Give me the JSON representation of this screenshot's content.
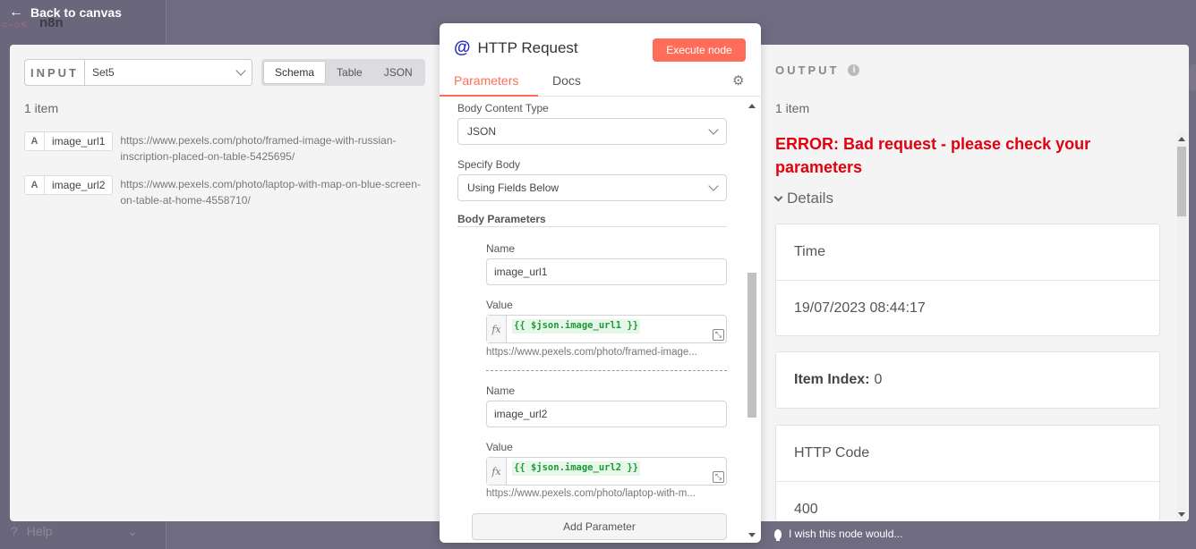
{
  "background": {
    "back_label": "Back to canvas",
    "logo_text": "n8n",
    "help_label": "Help"
  },
  "input": {
    "label": "INPUT",
    "source_node": "Set5",
    "views": [
      "Schema",
      "Table",
      "JSON"
    ],
    "active_view": "Schema",
    "item_count": "1 item",
    "fields": [
      {
        "type": "A",
        "key": "image_url1",
        "value": "https://www.pexels.com/photo/framed-image-with-russian-inscription-placed-on-table-5425695/"
      },
      {
        "type": "A",
        "key": "image_url2",
        "value": "https://www.pexels.com/photo/laptop-with-map-on-blue-screen-on-table-at-home-4558710/"
      }
    ]
  },
  "node": {
    "icon": "@",
    "title": "HTTP Request",
    "execute_label": "Execute node",
    "tabs": [
      "Parameters",
      "Docs"
    ],
    "active_tab": "Parameters",
    "body_content_type_label": "Body Content Type",
    "body_content_type_value": "JSON",
    "specify_body_label": "Specify Body",
    "specify_body_value": "Using Fields Below",
    "body_parameters_label": "Body Parameters",
    "params": [
      {
        "name_label": "Name",
        "name_value": "image_url1",
        "value_label": "Value",
        "expression": "{{ $json.image_url1 }}",
        "preview": "https://www.pexels.com/photo/framed-image..."
      },
      {
        "name_label": "Name",
        "name_value": "image_url2",
        "value_label": "Value",
        "expression": "{{ $json.image_url2 }}",
        "preview": "https://www.pexels.com/photo/laptop-with-m..."
      }
    ],
    "add_parameter_label": "Add Parameter"
  },
  "output": {
    "label": "OUTPUT",
    "item_count": "1 item",
    "error": "ERROR: Bad request - please check your parameters",
    "details_label": "Details",
    "time_label": "Time",
    "time_value": "19/07/2023 08:44:17",
    "item_index_label": "Item Index:",
    "item_index_value": "0",
    "http_code_label": "HTTP Code",
    "http_code_value": "400"
  },
  "feedback": {
    "text": "I wish this node would..."
  },
  "colors": {
    "accent": "#ff6d5a",
    "error": "#e3000e",
    "node_icon": "#2a2db8",
    "expression_text": "#1a9b35"
  }
}
